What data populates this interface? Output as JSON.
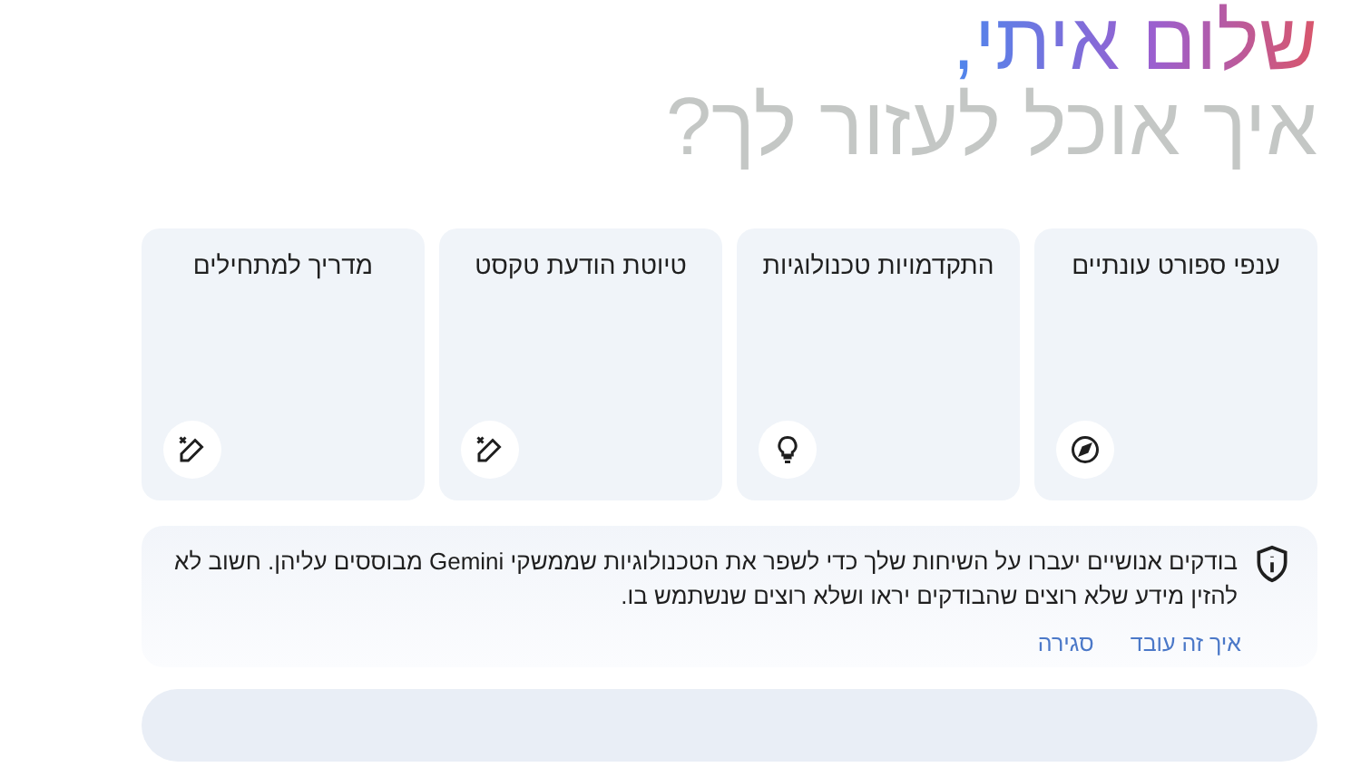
{
  "greeting": {
    "name_line": "שלום איתי,",
    "question": "איך אוכל לעזור לך?"
  },
  "cards": [
    {
      "label": "ענפי ספורט עונתיים",
      "kind": "explore"
    },
    {
      "label": "התקדמויות טכנולוגיות",
      "kind": "idea"
    },
    {
      "label": "טיוטת הודעת טקסט",
      "kind": "write"
    },
    {
      "label": "מדריך למתחילים",
      "kind": "write"
    }
  ],
  "notice": {
    "text": "בודקים אנושיים יעברו על השיחות שלך כדי לשפר את הטכנולוגיות שממשקי Gemini מבוססים עליהן. חשוב לא להזין מידע שלא רוצים שהבודקים יראו ושלא רוצים שנשתמש בו.",
    "links": [
      "איך זה עובד",
      "סגירה"
    ]
  }
}
